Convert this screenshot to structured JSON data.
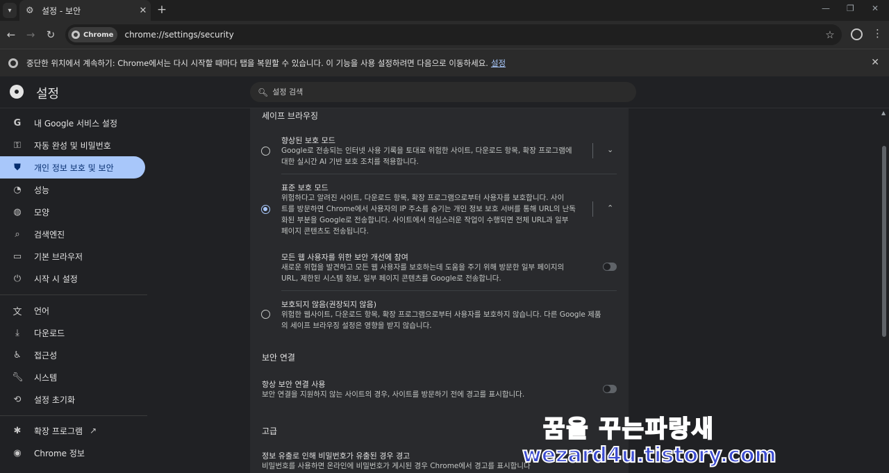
{
  "window": {
    "tab_title": "설정 - 보안",
    "url": "chrome://settings/security",
    "chip_label": "Chrome"
  },
  "infobar": {
    "message": "중단한 위치에서 계속하기: Chrome에서는 다시 시작할 때마다 탭을 복원할 수 있습니다. 이 기능을 사용 설정하려면 다음으로 이동하세요.",
    "link": "설정"
  },
  "header": {
    "title": "설정",
    "search_placeholder": "설정 검색"
  },
  "sidebar": {
    "items": [
      {
        "label": "내 Google 서비스 설정",
        "icon": "google-icon"
      },
      {
        "label": "자동 완성 및 비밀번호",
        "icon": "key-icon"
      },
      {
        "label": "개인 정보 보호 및 보안",
        "icon": "shield-icon"
      },
      {
        "label": "성능",
        "icon": "gauge-icon"
      },
      {
        "label": "모양",
        "icon": "palette-icon"
      },
      {
        "label": "검색엔진",
        "icon": "search-icon"
      },
      {
        "label": "기본 브라우저",
        "icon": "browser-window-icon"
      },
      {
        "label": "시작 시 설정",
        "icon": "power-icon"
      },
      {
        "label": "언어",
        "icon": "translate-icon"
      },
      {
        "label": "다운로드",
        "icon": "download-icon"
      },
      {
        "label": "접근성",
        "icon": "accessibility-icon"
      },
      {
        "label": "시스템",
        "icon": "wrench-icon"
      },
      {
        "label": "설정 초기화",
        "icon": "reset-icon"
      },
      {
        "label": "확장 프로그램",
        "icon": "extension-icon"
      },
      {
        "label": "Chrome 정보",
        "icon": "chrome-icon"
      }
    ],
    "active_index": 2
  },
  "main": {
    "safe_browsing_title": "세이프 브라우징",
    "enhanced": {
      "title": "향상된 보호 모드",
      "desc1": "Google로 전송되는 인터넷 사용 기록을 토대로 위험한 사이트, 다운로드 항목, 확장 프로그램에",
      "desc2": "대한 실시간 AI 기반 보호 조치를 적용합니다."
    },
    "standard": {
      "title": "표준 보호 모드",
      "desc1": "위험하다고 알려진 사이트, 다운로드 항목, 확장 프로그램으로부터 사용자를 보호합니다. 사이",
      "desc2": "트를 방문하면 Chrome에서 사용자의 IP 주소를 숨기는 개인 정보 보호 서버를 통해 URL의 난독",
      "desc3": "화된 부분을 Google로 전송합니다. 사이트에서 의심스러운 작업이 수행되면 전체 URL과 일부",
      "desc4": "페이지 콘텐츠도 전송됩니다."
    },
    "improve": {
      "title": "모든 웹 사용자를 위한 보안 개선에 참여",
      "desc1": "새로운 위협을 발견하고 모든 웹 사용자를 보호하는데 도움을 주기 위해 방문한 일부 페이지의",
      "desc2": "URL, 제한된 시스템 정보, 일부 페이지 콘텐츠를 Google로 전송합니다."
    },
    "none": {
      "title": "보호되지 않음(권장되지 않음)",
      "desc1": "위험한 웹사이트, 다운로드 항목, 확장 프로그램으로부터 사용자를 보호하지 않습니다. 다른 Google 제품",
      "desc2": "의 세이프 브라우징 설정은 영향을 받지 않습니다."
    },
    "secure_conn_title": "보안 연결",
    "https": {
      "title": "항상 보안 연결 사용",
      "desc": "보안 연결을 지원하지 않는 사이트의 경우, 사이트를 방문하기 전에 경고를 표시합니다."
    },
    "advanced_title": "고급",
    "leak": {
      "title": "정보 유출로 인해 비밀번호가 유출된 경우 경고",
      "desc": "비밀번호를 사용하면 온라인에 비밀번호가 게시된 경우 Chrome에서 경고를 표시합니다"
    }
  },
  "watermark": {
    "line1": "꿈을 꾸는파랑새",
    "line2": "wezard4u.tistory.com"
  }
}
